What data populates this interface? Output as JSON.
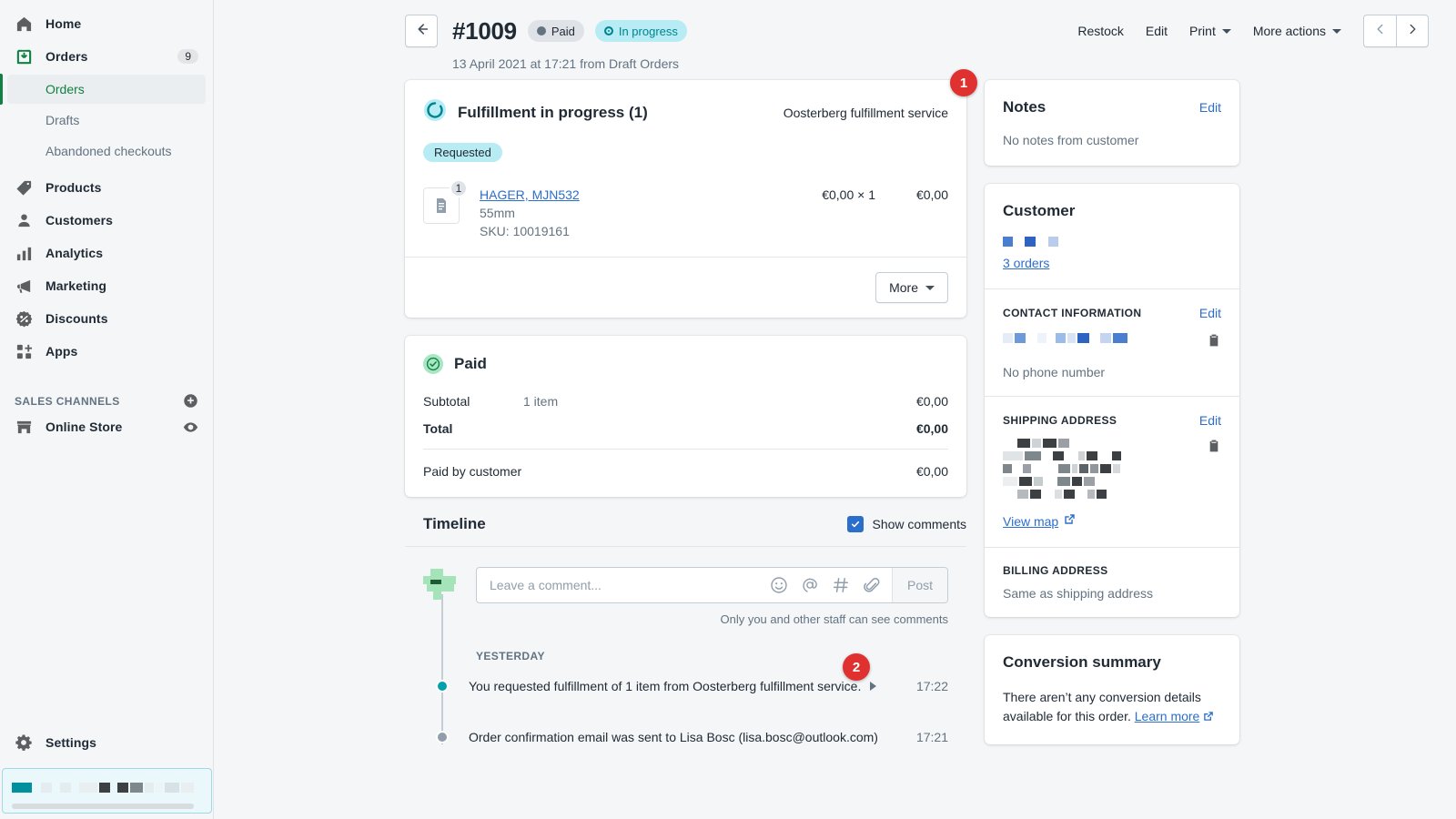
{
  "sidebar": {
    "items": [
      {
        "label": "Home",
        "icon": "home-icon",
        "badge": ""
      },
      {
        "label": "Orders",
        "icon": "orders-icon",
        "badge": "9"
      },
      {
        "label": "Products",
        "icon": "tag-icon",
        "badge": ""
      },
      {
        "label": "Customers",
        "icon": "person-icon",
        "badge": ""
      },
      {
        "label": "Analytics",
        "icon": "bar-chart-icon",
        "badge": ""
      },
      {
        "label": "Marketing",
        "icon": "megaphone-icon",
        "badge": ""
      },
      {
        "label": "Discounts",
        "icon": "discount-icon",
        "badge": ""
      },
      {
        "label": "Apps",
        "icon": "apps-icon",
        "badge": ""
      }
    ],
    "sub_items": [
      {
        "label": "Orders",
        "active": true
      },
      {
        "label": "Drafts",
        "active": false
      },
      {
        "label": "Abandoned checkouts",
        "active": false
      }
    ],
    "sales_channels_label": "SALES CHANNELS",
    "add_channel_icon": "plus-circle-icon",
    "online_store": {
      "label": "Online Store",
      "icon": "store-icon",
      "view_icon": "eye-icon"
    },
    "settings": {
      "label": "Settings",
      "icon": "gear-icon"
    },
    "store_switcher": {
      "redacted": true
    }
  },
  "header": {
    "back_icon": "arrow-left-icon",
    "order_number": "#1009",
    "status_payment": "Paid",
    "status_fulfillment": "In progress",
    "meta": "13 April 2021 at 17:21 from Draft Orders",
    "actions": [
      {
        "label": "Restock",
        "caret": false
      },
      {
        "label": "Edit",
        "caret": false
      },
      {
        "label": "Print",
        "caret": true
      },
      {
        "label": "More actions",
        "caret": true
      }
    ],
    "prev_icon": "chevron-left-icon",
    "next_icon": "chevron-right-icon"
  },
  "fulfillment": {
    "icon": "spinner-icon",
    "title": "Fulfillment in progress (1)",
    "service": "Oosterberg fulfillment service",
    "status_badge": "Requested",
    "item": {
      "thumb_icon": "document-icon",
      "quantity_badge": "1",
      "name": "HAGER, MJN532",
      "variant": "55mm",
      "sku": "SKU: 10019161",
      "unit_price": "€0,00 × 1",
      "line_total": "€0,00"
    },
    "more_button": "More"
  },
  "payment": {
    "icon": "check-circle-icon",
    "title": "Paid",
    "rows": [
      {
        "label": "Subtotal",
        "mid": "1 item",
        "value": "€0,00",
        "bold": false
      },
      {
        "label": "Total",
        "mid": "",
        "value": "€0,00",
        "bold": true
      }
    ],
    "paid_by_customer_label": "Paid by customer",
    "paid_by_customer_value": "€0,00"
  },
  "timeline": {
    "title": "Timeline",
    "show_comments_label": "Show comments",
    "show_comments_checked": true,
    "comment_placeholder": "Leave a comment...",
    "composer_icons": [
      "emoji-icon",
      "mention-icon",
      "hashtag-icon",
      "attachment-icon"
    ],
    "post_button": "Post",
    "privacy_note": "Only you and other staff can see comments",
    "day_label": "YESTERDAY",
    "events": [
      {
        "text": "You requested fulfillment of 1 item from Oosterberg fulfillment service.",
        "time": "17:22",
        "expandable": true,
        "dot": "teal"
      },
      {
        "text": "Order confirmation email was sent to Lisa Bosc (lisa.bosc@outlook.com)",
        "time": "17:21",
        "expandable": false,
        "dot": "gray"
      }
    ]
  },
  "notes": {
    "title": "Notes",
    "edit_label": "Edit",
    "body": "No notes from customer"
  },
  "customer": {
    "title": "Customer",
    "orders_link": "3 orders",
    "contact_information": {
      "label": "CONTACT INFORMATION",
      "edit_label": "Edit",
      "copy_icon": "clipboard-icon",
      "phone": "No phone number"
    },
    "shipping_address": {
      "label": "SHIPPING ADDRESS",
      "edit_label": "Edit",
      "copy_icon": "clipboard-icon",
      "view_map": "View map",
      "external_icon": "external-link-icon"
    },
    "billing_address": {
      "label": "BILLING ADDRESS",
      "value": "Same as shipping address"
    }
  },
  "conversion": {
    "title": "Conversion summary",
    "body": "There aren’t any conversion details available for this order.",
    "learn_more": "Learn more",
    "external_icon": "external-link-icon"
  },
  "annotations": [
    {
      "number": "1"
    },
    {
      "number": "2"
    }
  ],
  "colors": {
    "accent_green": "#108043",
    "link_blue": "#2c6ecb",
    "teal": "#00848e",
    "badge_red": "#e03131",
    "page_bg": "#f4f6f8"
  }
}
